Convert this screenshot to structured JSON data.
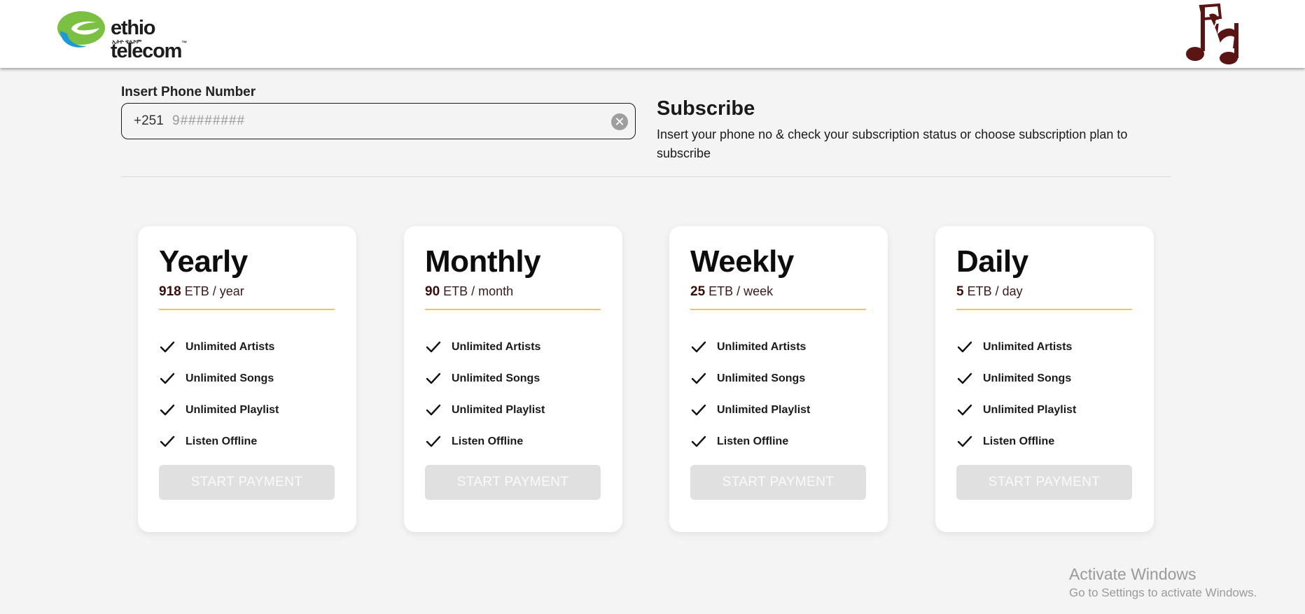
{
  "header": {
    "logo_text": "ethio telecom",
    "logo_tm": "™",
    "logo_subtext": "ኢትዮ ቴሌኮም"
  },
  "subscribe_form": {
    "phone_label": "Insert Phone Number",
    "country_code": "+251",
    "phone_placeholder": "9########",
    "phone_value": "",
    "clear_icon": "✕"
  },
  "intro": {
    "title": "Subscribe",
    "description": "Insert your phone no & check your subscription status or choose subscription plan to subscribe"
  },
  "plans": [
    {
      "name": "Yearly",
      "amount": "918",
      "unit": "ETB / year",
      "features": [
        "Unlimited Artists",
        "Unlimited Songs",
        "Unlimited Playlist",
        "Listen Offline"
      ],
      "button": "START PAYMENT"
    },
    {
      "name": "Monthly",
      "amount": "90",
      "unit": "ETB / month",
      "features": [
        "Unlimited Artists",
        "Unlimited Songs",
        "Unlimited Playlist",
        "Listen Offline"
      ],
      "button": "START PAYMENT"
    },
    {
      "name": "Weekly",
      "amount": "25",
      "unit": "ETB / week",
      "features": [
        "Unlimited Artists",
        "Unlimited Songs",
        "Unlimited Playlist",
        "Listen Offline"
      ],
      "button": "START PAYMENT"
    },
    {
      "name": "Daily",
      "amount": "5",
      "unit": "ETB / day",
      "features": [
        "Unlimited Artists",
        "Unlimited Songs",
        "Unlimited Playlist",
        "Listen Offline"
      ],
      "button": "START PAYMENT"
    }
  ],
  "watermark": {
    "title": "Activate Windows",
    "subtitle": "Go to Settings to activate Windows."
  },
  "colors": {
    "accent_rule": "#f5c452",
    "price_text": "#3a0d0d",
    "button_disabled": "#e0e0e0",
    "brand_green": "#7bc043",
    "brand_blue": "#1d9ad6",
    "app_icon": "#5a1414"
  },
  "icons": {
    "feature": "check-icon",
    "clear": "clear-circle-icon",
    "brand": "ethio-telecom-logo",
    "app": "music-note-icon"
  }
}
